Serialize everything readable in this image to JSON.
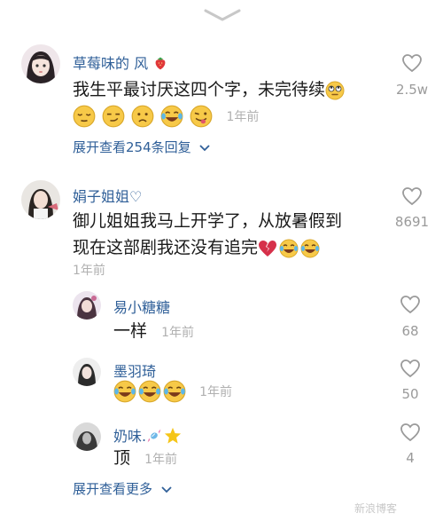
{
  "comments": [
    {
      "author": "草莓味的 风",
      "text_line1": "我生平最讨厌这四个字，未完待续",
      "time": "1年前",
      "likes": "2.5w",
      "expand": "展开查看254条回复"
    },
    {
      "author": "娟子姐姐♡",
      "text_line1": "御儿姐姐我马上开学了，从放暑假到",
      "text_line2": "现在这部剧我还没有追完",
      "time": "1年前",
      "likes": "8691"
    }
  ],
  "replies": [
    {
      "author": "易小糖糖",
      "text": "一样",
      "time": "1年前",
      "likes": "68"
    },
    {
      "author": "墨羽琦",
      "text": "",
      "time": "1年前",
      "likes": "50"
    },
    {
      "author": "奶味.",
      "text": "顶",
      "time": "1年前",
      "likes": "4"
    }
  ],
  "more_replies": "展开查看更多",
  "watermark": "新浪博客",
  "colors": {
    "name": "#2f5f98",
    "meta": "#b0b0b0",
    "like_outline": "#9a9a9a"
  }
}
